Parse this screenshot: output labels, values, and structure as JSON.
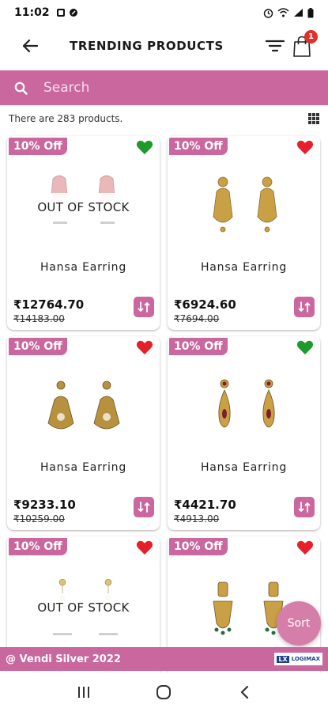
{
  "status_bar": {
    "time": "11:02"
  },
  "header": {
    "title": "TRENDING PRODUCTS",
    "cart_count": "1"
  },
  "search": {
    "placeholder": "Search"
  },
  "listing": {
    "count_text": "There are 283 products."
  },
  "products": [
    {
      "discount": "10% Off",
      "wishlisted": false,
      "heart_color": "#1e9a2b",
      "stock_label": "OUT OF STOCK",
      "name": "Hansa Earring",
      "price": "₹12764.70",
      "mrp": "₹14183.00"
    },
    {
      "discount": "10% Off",
      "wishlisted": true,
      "heart_color": "#e5202a",
      "stock_label": "",
      "name": "Hansa Earring",
      "price": "₹6924.60",
      "mrp": "₹7694.00"
    },
    {
      "discount": "10% Off",
      "wishlisted": true,
      "heart_color": "#e5202a",
      "stock_label": "",
      "name": "Hansa Earring",
      "price": "₹9233.10",
      "mrp": "₹10259.00"
    },
    {
      "discount": "10% Off",
      "wishlisted": false,
      "heart_color": "#1e9a2b",
      "stock_label": "",
      "name": "Hansa Earring",
      "price": "₹4421.70",
      "mrp": "₹4913.00"
    },
    {
      "discount": "10% Off",
      "wishlisted": true,
      "heart_color": "#e5202a",
      "stock_label": "OUT OF STOCK",
      "name": "",
      "price": "",
      "mrp": ""
    },
    {
      "discount": "10% Off",
      "wishlisted": true,
      "heart_color": "#e5202a",
      "stock_label": "",
      "name": "",
      "price": "",
      "mrp": ""
    }
  ],
  "fab": {
    "label": "Sort"
  },
  "footer": {
    "copyright": "@ Vendi Silver 2022",
    "brand_logo": "LOGIMAX"
  },
  "colors": {
    "accent": "#c9679e",
    "heart_red": "#e5202a",
    "heart_green": "#1e9a2b"
  },
  "icons": [
    "back-arrow-icon",
    "filter-icon",
    "cart-icon",
    "search-icon",
    "grid-view-icon",
    "heart-icon",
    "compare-icon",
    "recent-apps-icon",
    "home-icon",
    "back-nav-icon"
  ]
}
